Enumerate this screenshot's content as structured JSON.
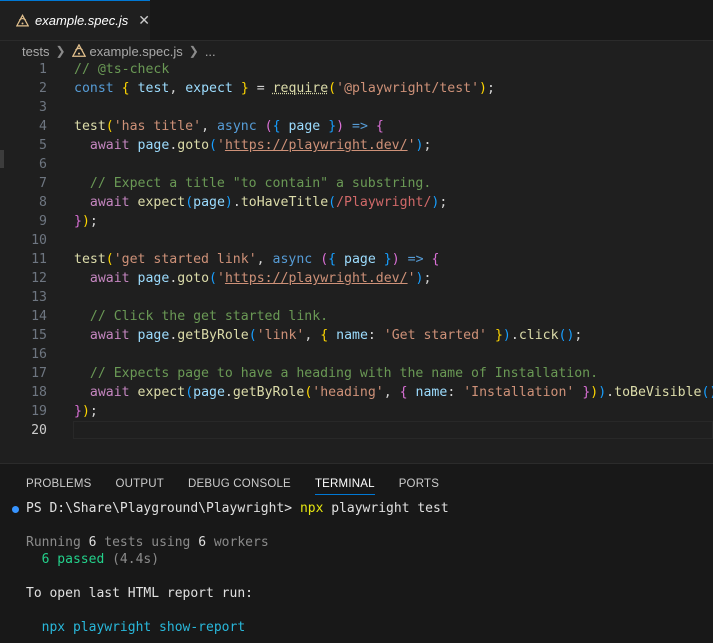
{
  "tab": {
    "title": "example.spec.js",
    "close_glyph": "✕"
  },
  "breadcrumb": {
    "folder": "tests",
    "file": "example.spec.js",
    "more": "..."
  },
  "editor": {
    "line_numbers": [
      "1",
      "2",
      "3",
      "4",
      "5",
      "6",
      "7",
      "8",
      "9",
      "10",
      "11",
      "12",
      "13",
      "14",
      "15",
      "16",
      "17",
      "18",
      "19",
      "20"
    ],
    "active_line": "20",
    "lines": [
      [
        [
          "c-cm",
          "// @ts-check"
        ]
      ],
      [
        [
          "c-kw",
          "const"
        ],
        [
          "c-op",
          " "
        ],
        [
          "c-br1",
          "{"
        ],
        [
          "c-op",
          " "
        ],
        [
          "c-var",
          "test"
        ],
        [
          "c-op",
          ", "
        ],
        [
          "c-var",
          "expect"
        ],
        [
          "c-op",
          " "
        ],
        [
          "c-br1",
          "}"
        ],
        [
          "c-op",
          " = "
        ],
        [
          "c-fnund",
          "require"
        ],
        [
          "c-br1",
          "("
        ],
        [
          "c-str",
          "'@playwright/test'"
        ],
        [
          "c-br1",
          ")"
        ],
        [
          "c-op",
          ";"
        ]
      ],
      [],
      [
        [
          "c-fn",
          "test"
        ],
        [
          "c-br1",
          "("
        ],
        [
          "c-str",
          "'has title'"
        ],
        [
          "c-op",
          ", "
        ],
        [
          "c-kw",
          "async"
        ],
        [
          "c-op",
          " "
        ],
        [
          "c-br2",
          "("
        ],
        [
          "c-br3",
          "{"
        ],
        [
          "c-op",
          " "
        ],
        [
          "c-var",
          "page"
        ],
        [
          "c-op",
          " "
        ],
        [
          "c-br3",
          "}"
        ],
        [
          "c-br2",
          ")"
        ],
        [
          "c-op",
          " "
        ],
        [
          "c-arrow",
          "=>"
        ],
        [
          "c-op",
          " "
        ],
        [
          "c-br2",
          "{"
        ]
      ],
      [
        [
          "c-op",
          "  "
        ],
        [
          "c-kw2",
          "await"
        ],
        [
          "c-op",
          " "
        ],
        [
          "c-var",
          "page"
        ],
        [
          "c-op",
          "."
        ],
        [
          "c-fn",
          "goto"
        ],
        [
          "c-br3",
          "("
        ],
        [
          "c-str",
          "'"
        ],
        [
          "c-url",
          "https://playwright.dev/"
        ],
        [
          "c-str",
          "'"
        ],
        [
          "c-br3",
          ")"
        ],
        [
          "c-op",
          ";"
        ]
      ],
      [],
      [
        [
          "c-op",
          "  "
        ],
        [
          "c-cm",
          "// Expect a title \"to contain\" a substring."
        ]
      ],
      [
        [
          "c-op",
          "  "
        ],
        [
          "c-kw2",
          "await"
        ],
        [
          "c-op",
          " "
        ],
        [
          "c-fn",
          "expect"
        ],
        [
          "c-br3",
          "("
        ],
        [
          "c-var",
          "page"
        ],
        [
          "c-br3",
          ")"
        ],
        [
          "c-op",
          "."
        ],
        [
          "c-fn",
          "toHaveTitle"
        ],
        [
          "c-br3",
          "("
        ],
        [
          "c-rx",
          "/Playwright/"
        ],
        [
          "c-br3",
          ")"
        ],
        [
          "c-op",
          ";"
        ]
      ],
      [
        [
          "c-br2",
          "}"
        ],
        [
          "c-br1",
          ")"
        ],
        [
          "c-op",
          ";"
        ]
      ],
      [],
      [
        [
          "c-fn",
          "test"
        ],
        [
          "c-br1",
          "("
        ],
        [
          "c-str",
          "'get started link'"
        ],
        [
          "c-op",
          ", "
        ],
        [
          "c-kw",
          "async"
        ],
        [
          "c-op",
          " "
        ],
        [
          "c-br2",
          "("
        ],
        [
          "c-br3",
          "{"
        ],
        [
          "c-op",
          " "
        ],
        [
          "c-var",
          "page"
        ],
        [
          "c-op",
          " "
        ],
        [
          "c-br3",
          "}"
        ],
        [
          "c-br2",
          ")"
        ],
        [
          "c-op",
          " "
        ],
        [
          "c-arrow",
          "=>"
        ],
        [
          "c-op",
          " "
        ],
        [
          "c-br2",
          "{"
        ]
      ],
      [
        [
          "c-op",
          "  "
        ],
        [
          "c-kw2",
          "await"
        ],
        [
          "c-op",
          " "
        ],
        [
          "c-var",
          "page"
        ],
        [
          "c-op",
          "."
        ],
        [
          "c-fn",
          "goto"
        ],
        [
          "c-br3",
          "("
        ],
        [
          "c-str",
          "'"
        ],
        [
          "c-url",
          "https://playwright.dev/"
        ],
        [
          "c-str",
          "'"
        ],
        [
          "c-br3",
          ")"
        ],
        [
          "c-op",
          ";"
        ]
      ],
      [],
      [
        [
          "c-op",
          "  "
        ],
        [
          "c-cm",
          "// Click the get started link."
        ]
      ],
      [
        [
          "c-op",
          "  "
        ],
        [
          "c-kw2",
          "await"
        ],
        [
          "c-op",
          " "
        ],
        [
          "c-var",
          "page"
        ],
        [
          "c-op",
          "."
        ],
        [
          "c-fn",
          "getByRole"
        ],
        [
          "c-br3",
          "("
        ],
        [
          "c-str",
          "'link'"
        ],
        [
          "c-op",
          ", "
        ],
        [
          "c-br1",
          "{"
        ],
        [
          "c-op",
          " "
        ],
        [
          "c-var",
          "name"
        ],
        [
          "c-op",
          ": "
        ],
        [
          "c-str",
          "'Get started'"
        ],
        [
          "c-op",
          " "
        ],
        [
          "c-br1",
          "}"
        ],
        [
          "c-br3",
          ")"
        ],
        [
          "c-op",
          "."
        ],
        [
          "c-fn",
          "click"
        ],
        [
          "c-br3",
          "()"
        ],
        [
          "c-op",
          ";"
        ]
      ],
      [],
      [
        [
          "c-op",
          "  "
        ],
        [
          "c-cm",
          "// Expects page to have a heading with the name of Installation."
        ]
      ],
      [
        [
          "c-op",
          "  "
        ],
        [
          "c-kw2",
          "await"
        ],
        [
          "c-op",
          " "
        ],
        [
          "c-fn",
          "expect"
        ],
        [
          "c-br3",
          "("
        ],
        [
          "c-var",
          "page"
        ],
        [
          "c-op",
          "."
        ],
        [
          "c-fn",
          "getByRole"
        ],
        [
          "c-br1",
          "("
        ],
        [
          "c-str",
          "'heading'"
        ],
        [
          "c-op",
          ", "
        ],
        [
          "c-br2",
          "{"
        ],
        [
          "c-op",
          " "
        ],
        [
          "c-var",
          "name"
        ],
        [
          "c-op",
          ": "
        ],
        [
          "c-str",
          "'Installation'"
        ],
        [
          "c-op",
          " "
        ],
        [
          "c-br2",
          "}"
        ],
        [
          "c-br1",
          ")"
        ],
        [
          "c-br3",
          ")"
        ],
        [
          "c-op",
          "."
        ],
        [
          "c-fn",
          "toBeVisible"
        ],
        [
          "c-br3",
          "()"
        ],
        [
          "c-op",
          ";"
        ]
      ],
      [
        [
          "c-br2",
          "}"
        ],
        [
          "c-br1",
          ")"
        ],
        [
          "c-op",
          ";"
        ]
      ],
      []
    ]
  },
  "panel": {
    "tabs": [
      "PROBLEMS",
      "OUTPUT",
      "DEBUG CONSOLE",
      "TERMINAL",
      "PORTS"
    ],
    "active_tab": "TERMINAL",
    "terminal": {
      "prompt": "PS D:\\Share\\Playground\\Playwright> ",
      "cmd_npx": "npx",
      "cmd_rest": " playwright test",
      "running_prefix": "Running ",
      "running_count": "6",
      "running_mid": " tests using ",
      "running_workers": "6",
      "running_suffix": " workers",
      "passed": "  6 passed",
      "passed_time": " (4.4s)",
      "report_msg": "To open last HTML report run:",
      "report_cmd": "  npx playwright show-report"
    }
  },
  "colors": {
    "accent": "#0078d4",
    "background": "#1f1f1f",
    "status_dot": "#3794ff"
  }
}
